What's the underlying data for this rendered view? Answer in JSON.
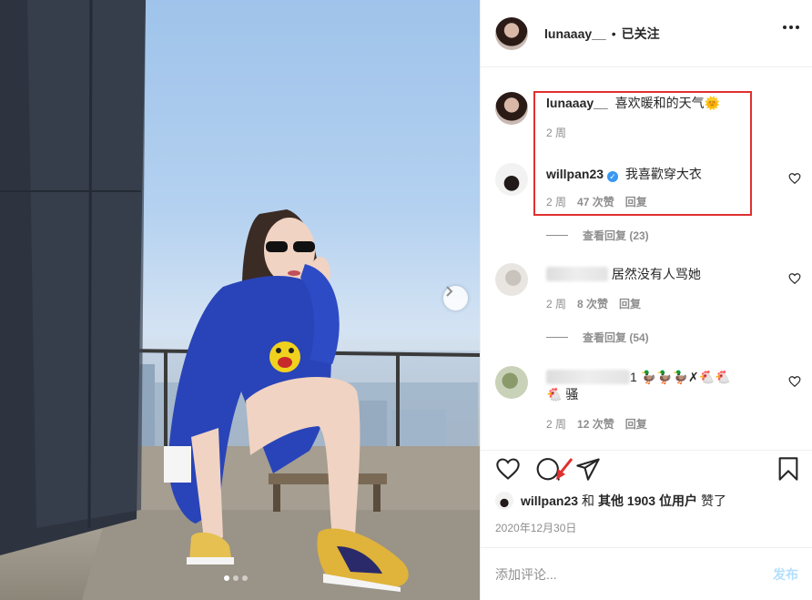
{
  "header": {
    "username": "lunaaay__",
    "separator": "•",
    "follow_label": "已关注"
  },
  "comments": [
    {
      "username": "lunaaay__",
      "text": "喜欢暖和的天气",
      "emoji": "🌞",
      "time": "2 周"
    },
    {
      "username": "willpan23",
      "verified": true,
      "text": "我喜歡穿大衣",
      "time": "2 周",
      "likes": "47 次赞",
      "reply_label": "回复"
    },
    {
      "view_replies": "查看回复 (23)"
    },
    {
      "username_hidden": true,
      "text": "居然没有人骂她",
      "time": "2 周",
      "likes": "8 次赞",
      "reply_label": "回复"
    },
    {
      "view_replies": "查看回复 (54)"
    },
    {
      "username_hidden": true,
      "prefix": "1",
      "emoji_line": "🦆🦆🦆✗🐔🐔",
      "line2_emoji": "🐔",
      "line2_text": "骚",
      "time": "2 周",
      "likes": "12 次赞",
      "reply_label": "回复"
    }
  ],
  "likes_line": {
    "user": "willpan23",
    "and": "和",
    "others": "其他 1903 位用户",
    "suffix": "赞了"
  },
  "date": "2020年12月30日",
  "add_comment": {
    "placeholder": "添加评论...",
    "post_label": "发布"
  },
  "carousel": {
    "dots": 3,
    "active": 0
  },
  "colors": {
    "highlight_box": "#e03030",
    "link_blue": "#b2dffc",
    "verified": "#3897f0"
  },
  "icons": [
    "heart-icon",
    "comment-icon",
    "share-icon",
    "bookmark-icon",
    "more-icon",
    "chevron-right-icon"
  ]
}
